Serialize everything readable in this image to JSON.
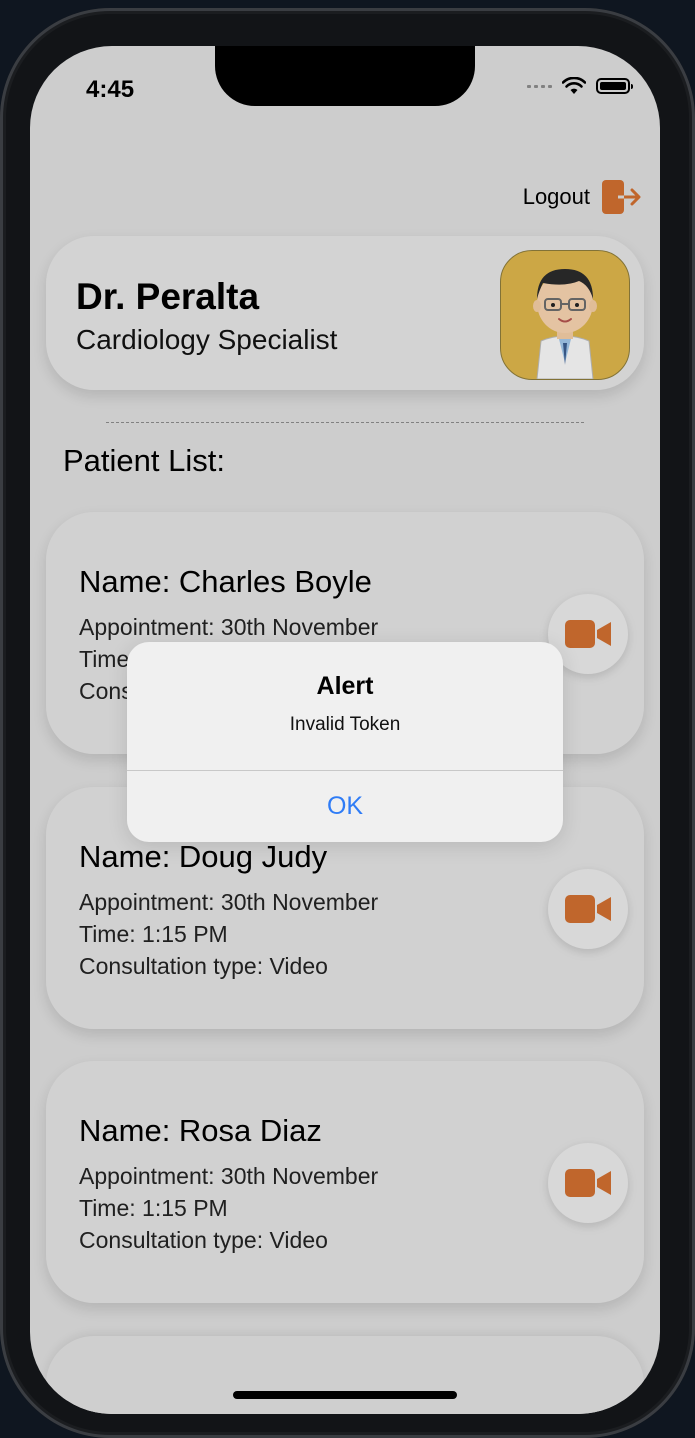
{
  "status_bar": {
    "time": "4:45"
  },
  "header": {
    "logout_label": "Logout"
  },
  "doctor": {
    "name": "Dr. Peralta",
    "specialty": "Cardiology Specialist"
  },
  "patients_section": {
    "title": "Patient List:"
  },
  "patients": [
    {
      "name": "Name: Charles Boyle",
      "appointment": "Appointment: 30th November",
      "time": "Time: 1:15 PM",
      "consultation": "Consultation type: Video"
    },
    {
      "name": "Name: Doug Judy",
      "appointment": "Appointment: 30th November",
      "time": "Time: 1:15 PM",
      "consultation": "Consultation type: Video"
    },
    {
      "name": "Name: Rosa Diaz",
      "appointment": "Appointment: 30th November",
      "time": "Time: 1:15 PM",
      "consultation": "Consultation type: Video"
    }
  ],
  "alert": {
    "title": "Alert",
    "message": "Invalid Token",
    "ok_label": "OK"
  },
  "colors": {
    "accent": "#cc6d2f",
    "link": "#2f7cf6"
  }
}
